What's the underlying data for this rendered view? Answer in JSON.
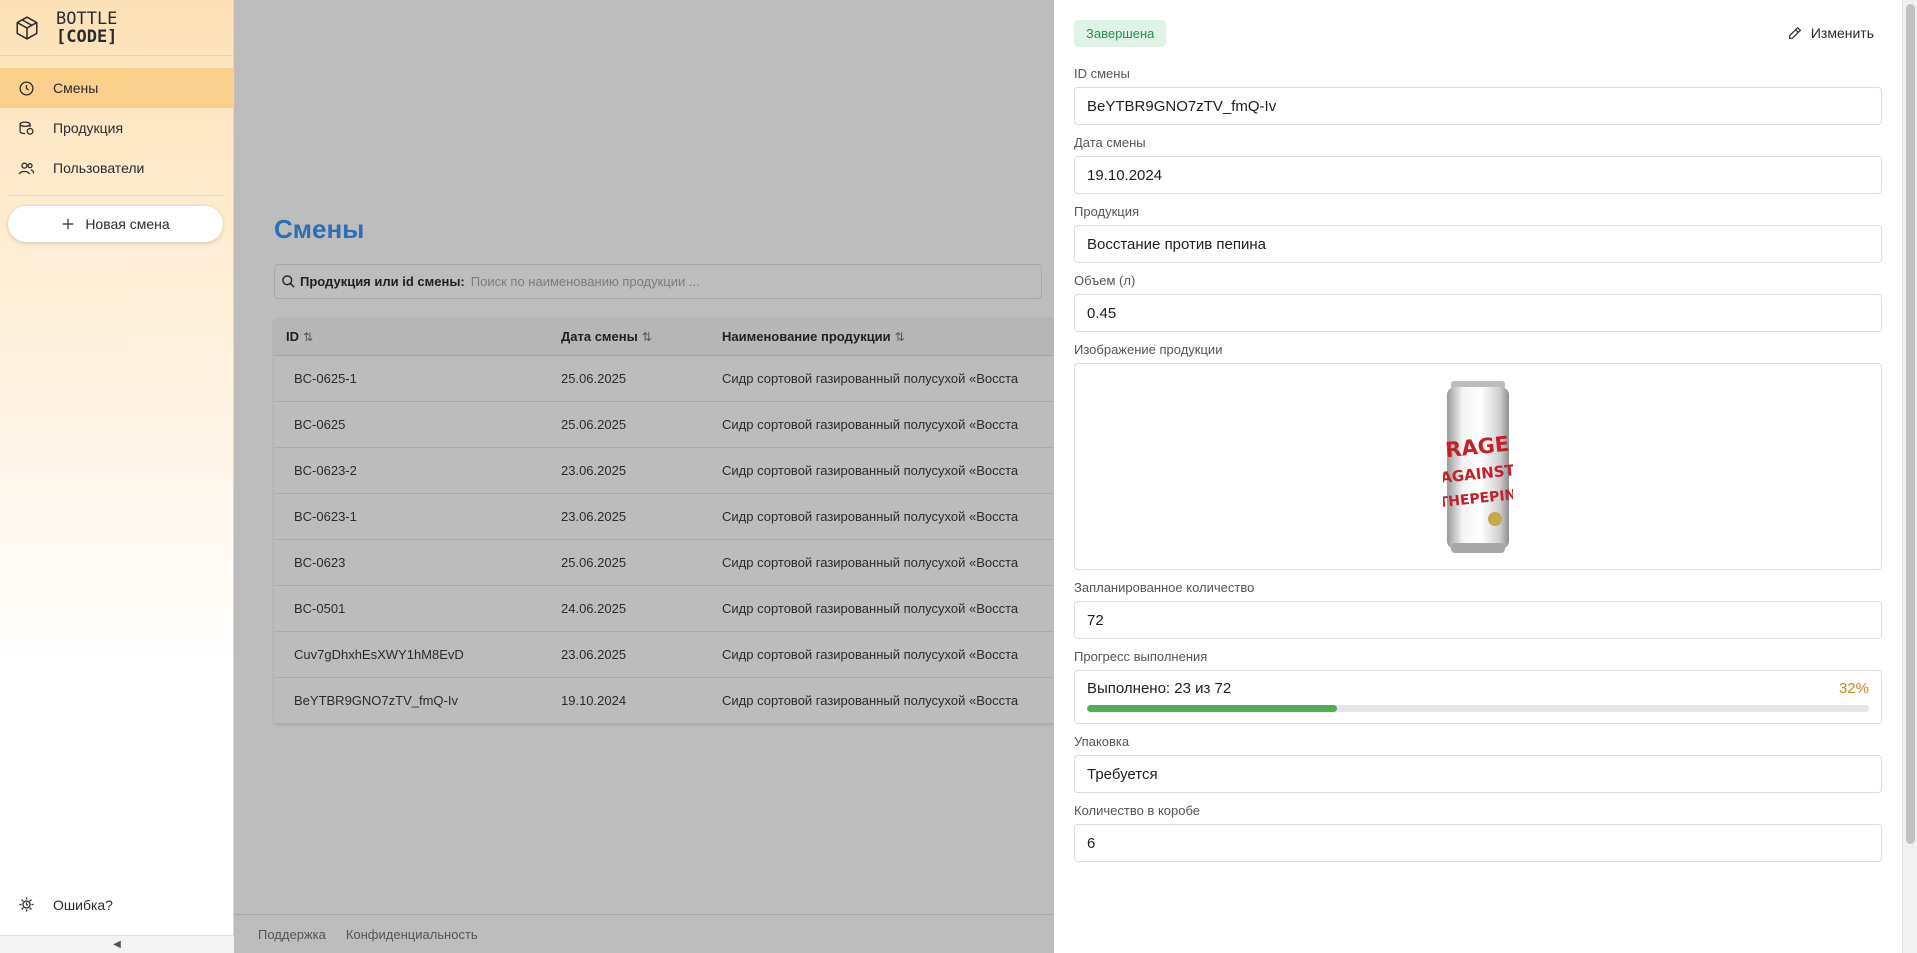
{
  "brand": {
    "line1": "BOTTLE",
    "line2": "[CODE]"
  },
  "sidebar": {
    "items": [
      {
        "label": "Смены",
        "icon": "clock-icon",
        "active": true
      },
      {
        "label": "Продукция",
        "icon": "database-icon",
        "active": false
      },
      {
        "label": "Пользователи",
        "icon": "users-icon",
        "active": false
      }
    ],
    "new_shift_label": "Новая смена",
    "error_label": "Ошибка?",
    "collapse_glyph": "◀"
  },
  "main": {
    "title": "Смены",
    "search": {
      "label": "Продукция или id смены:",
      "placeholder": "Поиск по наименованию продукции ..."
    },
    "table": {
      "columns": [
        "ID",
        "Дата смены",
        "Наименование продукции"
      ],
      "sort_glyph": "⇅",
      "rows": [
        {
          "id": "BC-0625-1",
          "date": "25.06.2025",
          "product": "Сидр сортовой газированный полусухой «Восста"
        },
        {
          "id": "BC-0625",
          "date": "25.06.2025",
          "product": "Сидр сортовой газированный полусухой «Восста"
        },
        {
          "id": "BC-0623-2",
          "date": "23.06.2025",
          "product": "Сидр сортовой газированный полусухой «Восста"
        },
        {
          "id": "BC-0623-1",
          "date": "23.06.2025",
          "product": "Сидр сортовой газированный полусухой «Восста"
        },
        {
          "id": "BC-0623",
          "date": "25.06.2025",
          "product": "Сидр сортовой газированный полусухой «Восста"
        },
        {
          "id": "BC-0501",
          "date": "24.06.2025",
          "product": "Сидр сортовой газированный полусухой «Восста"
        },
        {
          "id": "Cuv7gDhxhEsXWY1hM8EvD",
          "date": "23.06.2025",
          "product": "Сидр сортовой газированный полусухой «Восста"
        },
        {
          "id": "BeYTBR9GNO7zTV_fmQ-Iv",
          "date": "19.10.2024",
          "product": "Сидр сортовой газированный полусухой «Восста"
        }
      ]
    },
    "footer": {
      "support": "Поддержка",
      "privacy": "Конфиденциальность"
    }
  },
  "panel": {
    "status": "Завершена",
    "edit_label": "Изменить",
    "fields": {
      "shift_id": {
        "label": "ID смены",
        "value": "BeYTBR9GNO7zTV_fmQ-Iv"
      },
      "shift_date": {
        "label": "Дата смены",
        "value": "19.10.2024"
      },
      "product": {
        "label": "Продукция",
        "value": "Восстание против пепина"
      },
      "volume": {
        "label": "Объем (л)",
        "value": "0.45"
      },
      "image": {
        "label": "Изображение продукции",
        "can_text": "RAGE AGAINST THE PEPIN"
      },
      "planned": {
        "label": "Запланированное количество",
        "value": "72"
      },
      "progress": {
        "label": "Прогресс выполнения",
        "text": "Выполнено: 23 из 72",
        "percent_label": "32%",
        "fraction": 0.32
      },
      "packaging": {
        "label": "Упаковка",
        "value": "Требуется"
      },
      "box_qty": {
        "label": "Количество в коробе",
        "value": "6"
      }
    }
  },
  "colors": {
    "accent": "#2d6fb7",
    "sidebar_active": "#fbcf8c",
    "progress": "#4caf50",
    "percent": "#c9871d",
    "status_bg": "#dff4e6",
    "status_fg": "#2e8b57"
  }
}
